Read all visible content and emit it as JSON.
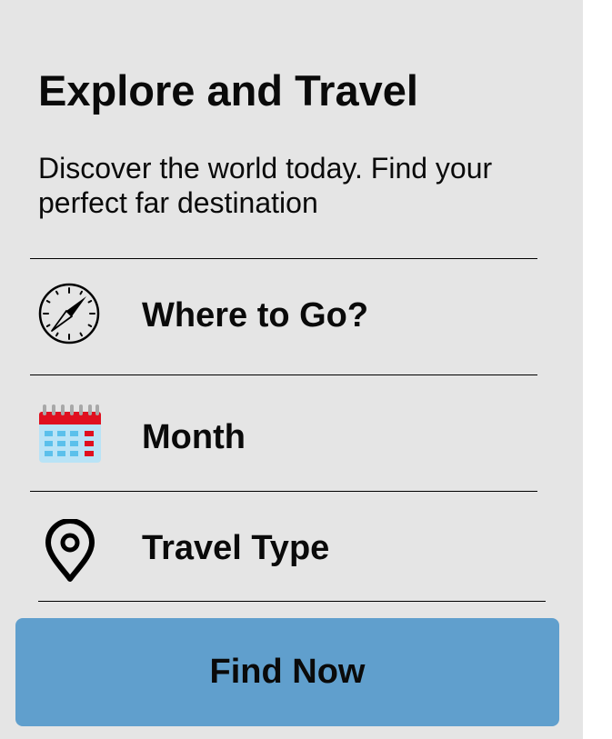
{
  "header": {
    "title": "Explore and Travel",
    "subtitle": "Discover the world today. Find your perfect far destination"
  },
  "options": [
    {
      "label": "Where to Go?",
      "icon": "compass-icon"
    },
    {
      "label": "Month",
      "icon": "calendar-icon"
    },
    {
      "label": "Travel Type",
      "icon": "location-pin-icon"
    }
  ],
  "action": {
    "label": "Find Now"
  },
  "colors": {
    "panel_background": "#e5e5e5",
    "button_background": "#609fcd",
    "calendar_header": "#e0101f",
    "calendar_body": "#b9e3f6",
    "calendar_cells": "#5bc0eb"
  }
}
